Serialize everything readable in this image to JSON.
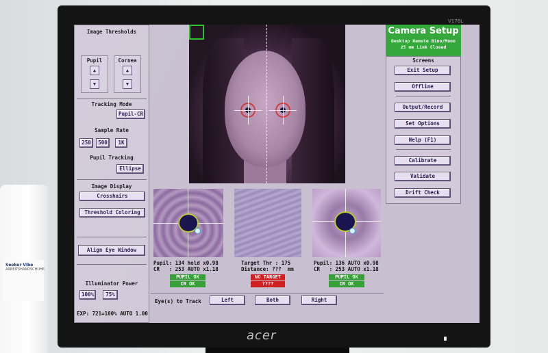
{
  "environment": {
    "bottle_label_title": "Seeker Vibe",
    "bottle_label_text": "ARBEITSHANDSCHUHE"
  },
  "monitor": {
    "brand": "acer",
    "model": "V176L"
  },
  "app": {
    "header": {
      "title": "Camera Setup",
      "mode": "Desktop Remote Bino/Mono",
      "link": "25 mm Link Closed"
    },
    "left_panel": {
      "image_thresholds_title": "Image Thresholds",
      "pupil_label": "Pupil",
      "cornea_label": "Cornea",
      "tracking_mode_title": "Tracking Mode",
      "tracking_mode_value": "Pupil-CR",
      "sample_rate_title": "Sample Rate",
      "sample_rates": [
        "250",
        "500",
        "1K"
      ],
      "pupil_tracking_title": "Pupil Tracking",
      "pupil_tracking_value": "Ellipse",
      "image_display_title": "Image Display",
      "crosshairs_label": "Crosshairs",
      "threshold_coloring_label": "Threshold Coloring",
      "align_eye_window_label": "Align Eye Window",
      "illuminator_title": "Illuminator Power",
      "illuminator_options": [
        "100%",
        "75%"
      ],
      "exposure": "EXP: 721=100% AUTO 1.00"
    },
    "right_panel": {
      "screens_title": "Screens",
      "buttons": {
        "exit_setup": "Exit Setup",
        "offline": "Offline",
        "output_record": "Output/Record",
        "set_options": "Set Options",
        "help": "Help (F1)",
        "calibrate": "Calibrate",
        "validate": "Validate",
        "drift_check": "Drift Check"
      }
    },
    "eye_left": {
      "line1": "Pupil: 134 hold x0.98",
      "line2": "CR   : 253 AUTO x1.18",
      "pupil_status": "PUPIL OK",
      "cr_status": "CR  OK"
    },
    "target": {
      "line1": "Target Thr : 175",
      "line2": "Distance: ???  mm",
      "status": "NO TARGET",
      "status2": "????"
    },
    "eye_right": {
      "line1": "Pupil: 136 AUTO x0.98",
      "line2": "CR   : 253 AUTO x1.18",
      "pupil_status": "PUPIL OK",
      "cr_status": "CR  OK"
    },
    "tracking": {
      "label": "Eye(s) to Track",
      "left": "Left",
      "both": "Both",
      "right": "Right"
    }
  }
}
